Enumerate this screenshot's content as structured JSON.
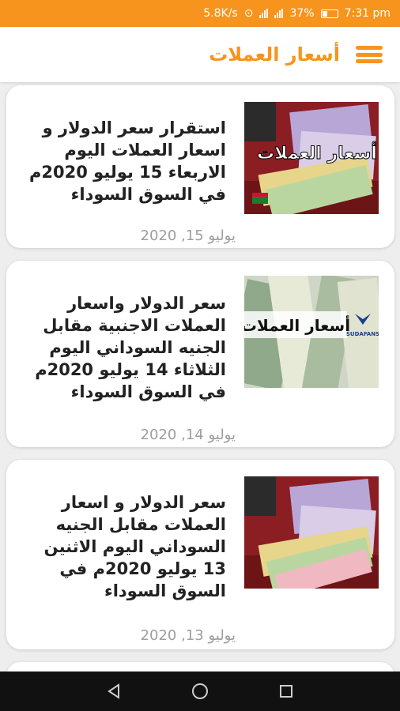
{
  "status_bar": {
    "speed": "5.8K/s",
    "battery": "37%",
    "time": "7:31 pm"
  },
  "app_bar": {
    "title": "أسعار العملات"
  },
  "articles": [
    {
      "title": "استقرار سعر الدولار و اسعار العملات اليوم الاربعاء 15 يوليو 2020م في السوق السوداء",
      "date": "يوليو 15, 2020",
      "thumb_text": "أسعار العملات"
    },
    {
      "title": "سعر الدولار واسعار العملات الاجنبية مقابل الجنيه السوداني اليوم الثلاثاء 14 يوليو 2020م في السوق السوداء",
      "date": "يوليو 14, 2020",
      "thumb_text": "أسعار العملات",
      "thumb_brand": "SUDAFANS"
    },
    {
      "title": "سعر الدولار و اسعار العملات مقابل الجنيه السوداني اليوم الاثنين 13 يوليو 2020م في السوق السوداء",
      "date": "يوليو 13, 2020"
    }
  ],
  "colors": {
    "accent": "#f7941d",
    "date_gray": "#9e9e9e"
  }
}
